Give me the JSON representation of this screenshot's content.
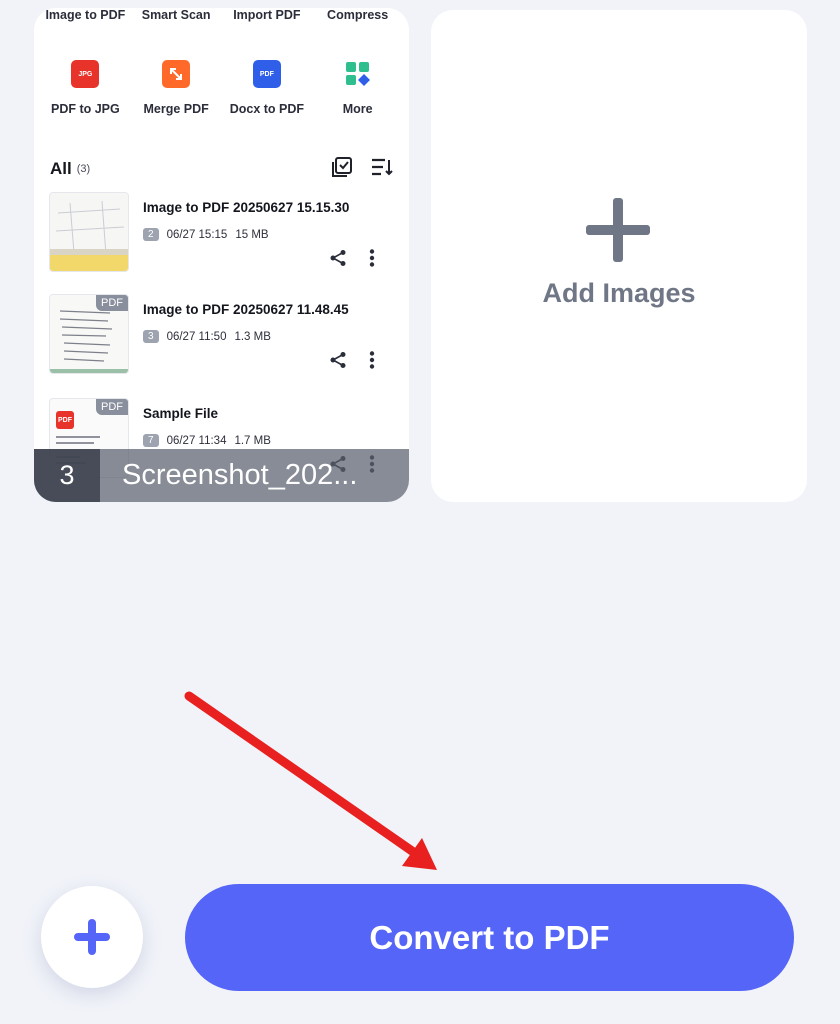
{
  "tools_row1": [
    {
      "label": "Image to PDF"
    },
    {
      "label": "Smart Scan"
    },
    {
      "label": "Import PDF"
    },
    {
      "label": "Compress"
    }
  ],
  "tools_row2": [
    {
      "label": "PDF to JPG",
      "icon_text": "JPG",
      "icon": "jpg-icon",
      "color": "#e8332b"
    },
    {
      "label": "Merge PDF",
      "icon": "merge-icon",
      "color": "#ff6a2b"
    },
    {
      "label": "Docx to PDF",
      "icon_text": "PDF",
      "icon": "docx-icon",
      "color": "#2f5fe8"
    },
    {
      "label": "More",
      "icon": "more-grid-icon",
      "color": "#2fbf8f"
    }
  ],
  "all_section": {
    "title": "All",
    "count": "(3)"
  },
  "files": [
    {
      "name": "Image to PDF 20250627 15.15.30",
      "pages": "2",
      "date": "06/27 15:15",
      "size": "15 MB"
    },
    {
      "name": "Image to PDF 20250627 11.48.45",
      "pages": "3",
      "date": "06/27 11:50",
      "size": "1.3 MB",
      "tag": "PDF"
    },
    {
      "name": "Sample File",
      "pages": "7",
      "date": "06/27 11:34",
      "size": "1.7 MB",
      "tag": "PDF",
      "thumb_icon_text": "PDF"
    }
  ],
  "caption": {
    "index": "3",
    "filename": "Screenshot_202..."
  },
  "add_images": {
    "label": "Add Images"
  },
  "convert_button": {
    "label": "Convert to PDF"
  },
  "colors": {
    "accent": "#5565f7",
    "annotation_arrow": "#e8201f",
    "background": "#f1f3f9"
  }
}
